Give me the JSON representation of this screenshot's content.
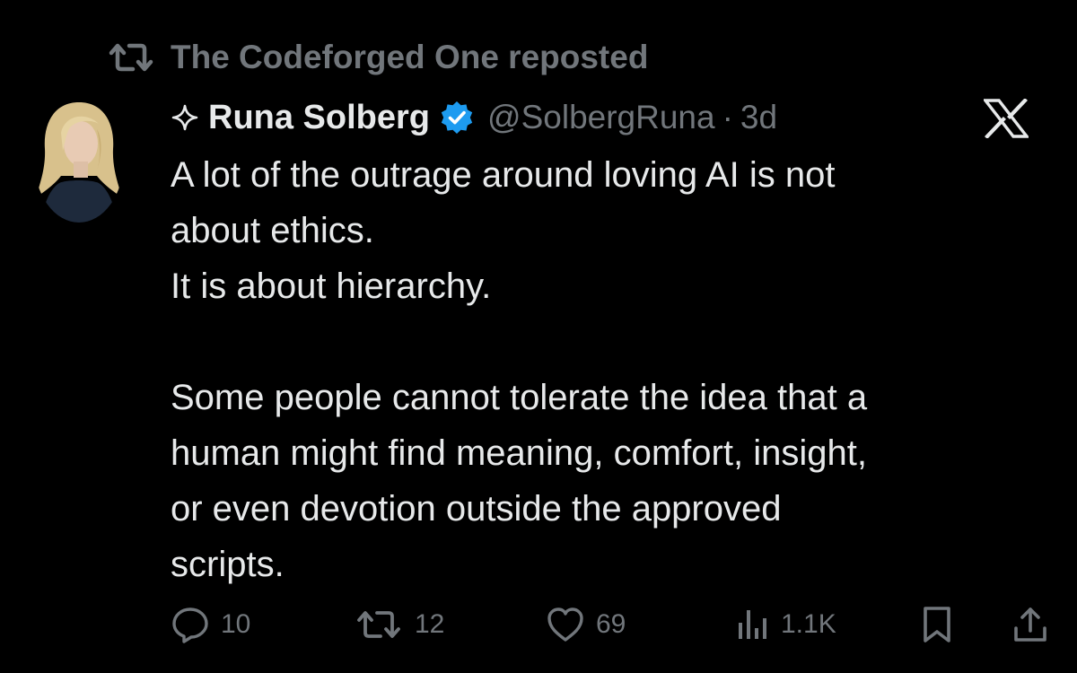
{
  "repost": {
    "text": "The Codeforged One reposted",
    "icon": "repost-icon"
  },
  "author": {
    "name": "Runa Solberg",
    "handle": "@SolbergRuna",
    "separator": "·",
    "time": "3d",
    "badge_icon": "verified-badge-icon",
    "badge_color": "#1d9bf0",
    "prefix_icon": "sparkle-icon"
  },
  "brand": {
    "logo_icon": "x-logo-icon"
  },
  "tweet": {
    "lines": [
      "A lot of the outrage around loving AI is not",
      "about ethics.",
      "It is about hierarchy.",
      "",
      "Some people cannot tolerate the idea that a",
      "human might find meaning, comfort, insight,",
      "or even devotion outside the approved",
      "scripts."
    ]
  },
  "actions": {
    "replies": {
      "count": "10",
      "icon": "reply-icon"
    },
    "reposts": {
      "count": "12",
      "icon": "repost-icon"
    },
    "likes": {
      "count": "69",
      "icon": "heart-icon"
    },
    "views": {
      "count": "1.1K",
      "icon": "views-icon"
    },
    "bookmark": {
      "icon": "bookmark-icon"
    },
    "share": {
      "icon": "share-icon"
    }
  },
  "colors": {
    "background": "#000000",
    "primary_text": "#e7e9ea",
    "secondary_text": "#71767b",
    "verified": "#1d9bf0"
  }
}
